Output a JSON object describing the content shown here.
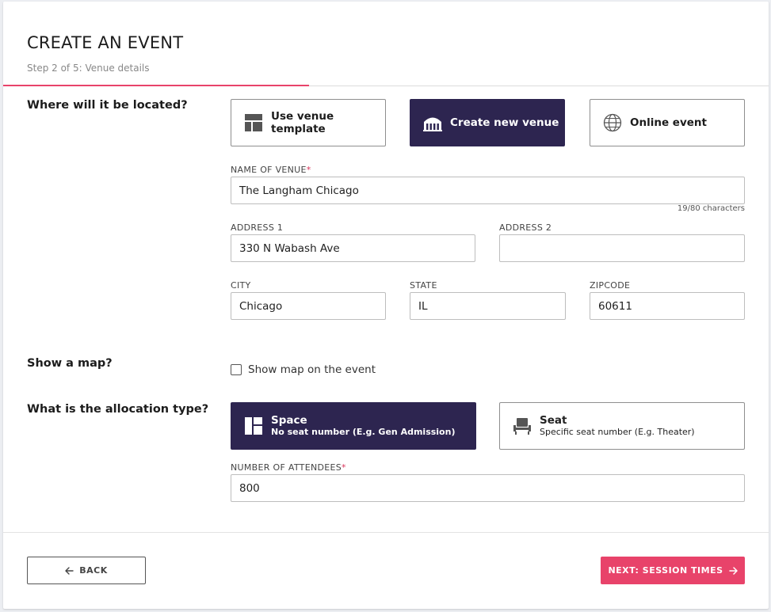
{
  "header": {
    "title": "CREATE AN EVENT",
    "subtitle": "Step 2 of 5: Venue details"
  },
  "location": {
    "question": "Where will it be located?",
    "options": [
      {
        "label": "Use venue template",
        "icon": "template-grid-icon",
        "selected": false
      },
      {
        "label": "Create new venue",
        "icon": "venue-building-icon",
        "selected": true
      },
      {
        "label": "Online event",
        "icon": "globe-icon",
        "selected": false
      }
    ]
  },
  "venue": {
    "name_label": "NAME OF VENUE",
    "required_mark": "*",
    "name_value": "The Langham Chicago",
    "name_counter": "19/80 characters",
    "address1_label": "ADDRESS 1",
    "address1_value": "330 N Wabash Ave",
    "address2_label": "ADDRESS 2",
    "address2_value": "",
    "city_label": "CITY",
    "city_value": "Chicago",
    "state_label": "STATE",
    "state_value": "IL",
    "zip_label": "ZIPCODE",
    "zip_value": "60611"
  },
  "map": {
    "question": "Show a map?",
    "checkbox_label": "Show map on the event",
    "checked": false
  },
  "allocation": {
    "question": "What is the allocation type?",
    "options": [
      {
        "title": "Space",
        "subtitle": "No seat number (E.g. Gen Admission)",
        "icon": "space-blocks-icon",
        "selected": true
      },
      {
        "title": "Seat",
        "subtitle": "Specific seat number (E.g. Theater)",
        "icon": "seat-chair-icon",
        "selected": false
      }
    ],
    "attendees_label": "NUMBER OF ATTENDEES",
    "attendees_value": "800"
  },
  "footer": {
    "back_label": "BACK",
    "next_label": "NEXT: SESSION TIMES"
  },
  "progress": {
    "step": 2,
    "total": 5
  },
  "colors": {
    "accent": "#e8436a",
    "selected": "#2d2550"
  }
}
